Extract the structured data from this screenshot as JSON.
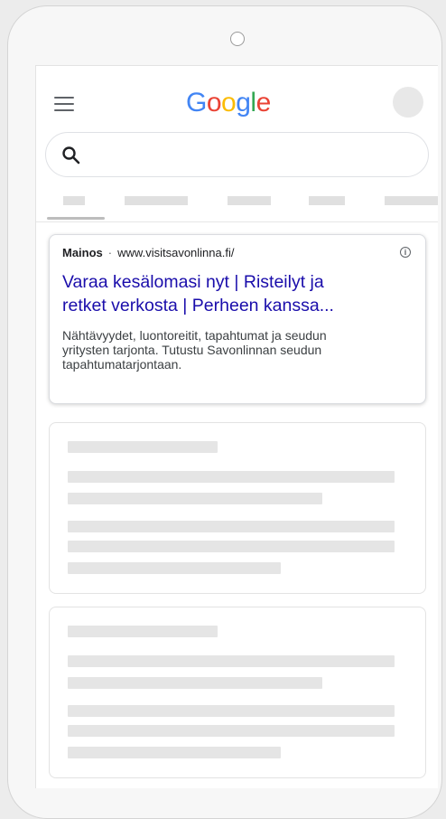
{
  "header": {
    "logo": {
      "G": "G",
      "o1": "o",
      "o2": "o",
      "g": "g",
      "l": "l",
      "e": "e"
    },
    "menu_icon": "hamburger-icon",
    "search_icon": "search-icon"
  },
  "search": {
    "value": ""
  },
  "ad": {
    "label": "Mainos",
    "separator": "·",
    "url": "www.visitsavonlinna.fi/",
    "info_symbol": "i",
    "title_line1": "Varaa kesälomasi nyt | Risteilyt ja",
    "title_line2": "retket verkosta | Perheen kanssa...",
    "desc_line1": "Nähtävyydet, luontoreitit, tapahtumat ja seudun",
    "desc_line2": "yritysten tarjonta. Tutustu Savonlinnan seudun",
    "desc_line3": "tapahtumatarjontaan."
  },
  "colors": {
    "google_blue": "#4285f4",
    "google_red": "#ea4335",
    "google_yellow": "#fbbc05",
    "google_green": "#34a853",
    "link": "#1a0dab"
  }
}
